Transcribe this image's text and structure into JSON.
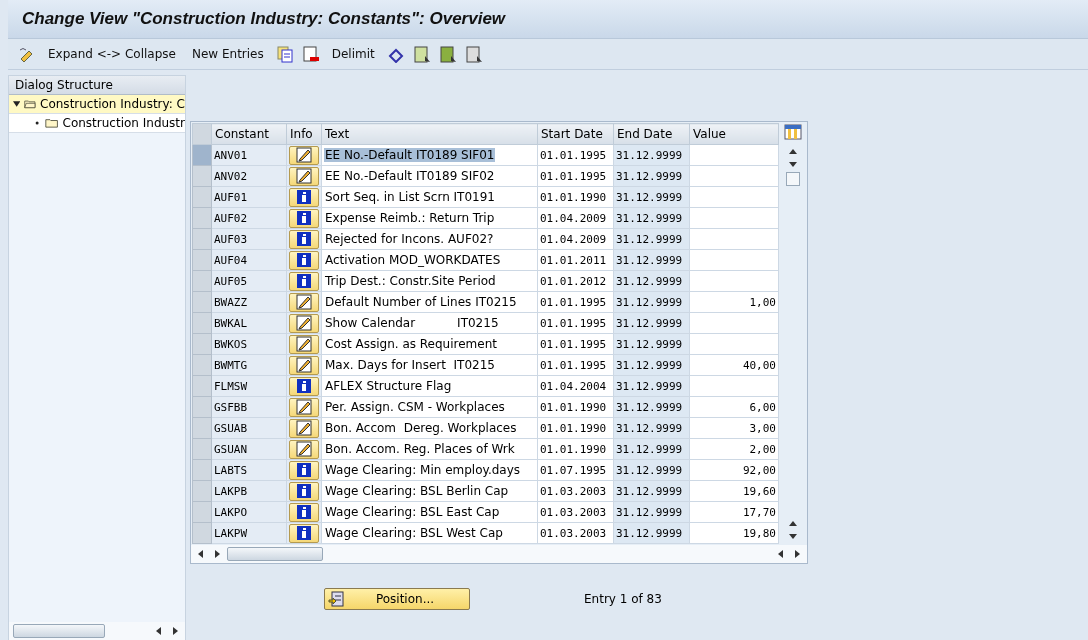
{
  "window": {
    "title": "Change View \"Construction Industry: Constants\": Overview"
  },
  "toolbar": [
    {
      "kind": "icon"
    },
    {
      "kind": "text",
      "label": "Expand <-> Collapse"
    },
    {
      "kind": "text",
      "label": "New Entries"
    },
    {
      "kind": "icon"
    },
    {
      "kind": "icon"
    },
    {
      "kind": "text",
      "label": "Delimit"
    },
    {
      "kind": "icon"
    },
    {
      "kind": "icon"
    },
    {
      "kind": "icon"
    },
    {
      "kind": "icon"
    }
  ],
  "sidebar": {
    "title": "Dialog Structure",
    "tree": [
      {
        "label": "Construction Industry: C",
        "expanded": true,
        "selected": true,
        "children": [
          {
            "label": "Construction Industr",
            "selected": false
          }
        ]
      }
    ]
  },
  "table": {
    "columns": [
      "Constant",
      "Info",
      "Text",
      "Start Date",
      "End Date",
      "Value"
    ],
    "rows": [
      {
        "constant": "ANV01",
        "kind": "edit",
        "text": "EE No.-Default IT0189 SIF01",
        "start": "01.01.1995",
        "end": "31.12.9999",
        "selected": true
      },
      {
        "constant": "ANV02",
        "kind": "edit",
        "text": "EE No.-Default IT0189 SIF02",
        "start": "01.01.1995",
        "end": "31.12.9999",
        "selected": false
      },
      {
        "constant": "AUF01",
        "kind": "info",
        "text": "Sort Seq. in List Scrn IT0191",
        "start": "01.01.1990",
        "end": "31.12.9999",
        "selected": false
      },
      {
        "constant": "AUF02",
        "kind": "info",
        "text": "Expense Reimb.: Return Trip",
        "start": "01.04.2009",
        "end": "31.12.9999",
        "selected": false
      },
      {
        "constant": "AUF03",
        "kind": "info",
        "text": "Rejected for Incons. AUF02?",
        "start": "01.04.2009",
        "end": "31.12.9999",
        "selected": false
      },
      {
        "constant": "AUF04",
        "kind": "info",
        "text": "Activation MOD_WORKDATES",
        "start": "01.01.2011",
        "end": "31.12.9999",
        "selected": false
      },
      {
        "constant": "AUF05",
        "kind": "info",
        "text": "Trip Dest.: Constr.Site Period",
        "start": "01.01.2012",
        "end": "31.12.9999",
        "selected": false
      },
      {
        "constant": "BWAZZ",
        "kind": "edit",
        "text": "Default Number of Lines IT0215",
        "start": "01.01.1995",
        "end": "31.12.9999",
        "value": "1,00",
        "selected": false
      },
      {
        "constant": "BWKAL",
        "kind": "edit",
        "text": "Show Calendar           IT0215",
        "start": "01.01.1995",
        "end": "31.12.9999",
        "selected": false
      },
      {
        "constant": "BWKOS",
        "kind": "edit",
        "text": "Cost Assign. as Requirement",
        "start": "01.01.1995",
        "end": "31.12.9999",
        "selected": false
      },
      {
        "constant": "BWMTG",
        "kind": "edit",
        "text": "Max. Days for Insert  IT0215",
        "start": "01.01.1995",
        "end": "31.12.9999",
        "value": "40,00",
        "selected": false
      },
      {
        "constant": "FLMSW",
        "kind": "info",
        "text": "AFLEX Structure Flag",
        "start": "01.04.2004",
        "end": "31.12.9999",
        "selected": false
      },
      {
        "constant": "GSFBB",
        "kind": "edit",
        "text": "Per. Assign. CSM - Workplaces",
        "start": "01.01.1990",
        "end": "31.12.9999",
        "value": "6,00",
        "selected": false
      },
      {
        "constant": "GSUAB",
        "kind": "edit",
        "text": "Bon. Accom  Dereg. Workplaces",
        "start": "01.01.1990",
        "end": "31.12.9999",
        "value": "3,00",
        "selected": false
      },
      {
        "constant": "GSUAN",
        "kind": "edit",
        "text": "Bon. Accom. Reg. Places of Wrk",
        "start": "01.01.1990",
        "end": "31.12.9999",
        "value": "2,00",
        "selected": false
      },
      {
        "constant": "LABTS",
        "kind": "info",
        "text": "Wage Clearing: Min employ.days",
        "start": "01.07.1995",
        "end": "31.12.9999",
        "value": "92,00",
        "selected": false
      },
      {
        "constant": "LAKPB",
        "kind": "info",
        "text": "Wage Clearing: BSL Berlin Cap",
        "start": "01.03.2003",
        "end": "31.12.9999",
        "value": "19,60",
        "selected": false
      },
      {
        "constant": "LAKPO",
        "kind": "info",
        "text": "Wage Clearing: BSL East Cap",
        "start": "01.03.2003",
        "end": "31.12.9999",
        "value": "17,70",
        "selected": false
      },
      {
        "constant": "LAKPW",
        "kind": "info",
        "text": "Wage Clearing: BSL West Cap",
        "start": "01.03.2003",
        "end": "31.12.9999",
        "value": "19,80",
        "selected": false
      }
    ]
  },
  "position_button": "Position...",
  "entry_count": "Entry 1 of 83"
}
